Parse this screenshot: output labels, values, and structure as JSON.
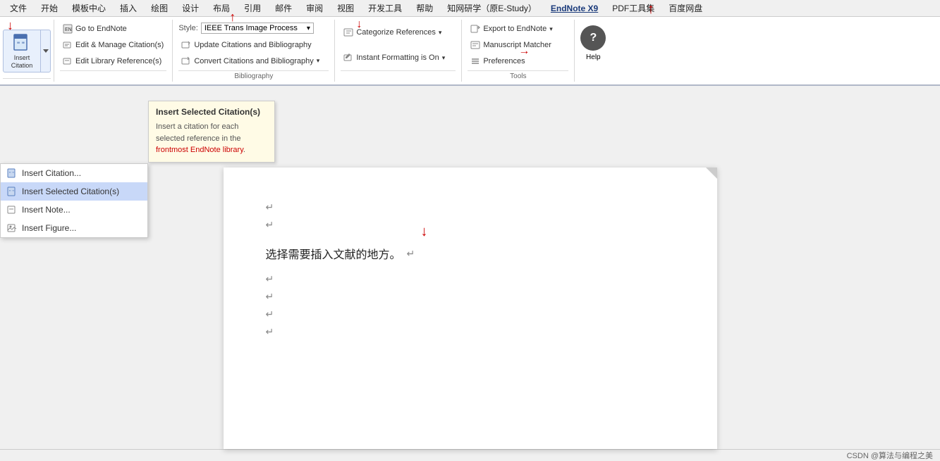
{
  "menubar": {
    "items": [
      "文件",
      "开始",
      "模板中心",
      "插入",
      "绘图",
      "设计",
      "布局",
      "引用",
      "邮件",
      "审阅",
      "视图",
      "开发工具",
      "帮助",
      "知网研学（原E-Study）",
      "EndNote X9",
      "PDF工具集",
      "百度网盘"
    ]
  },
  "ribbon": {
    "insert_citation": {
      "main_label": "Insert\nCitation",
      "dropdown_arrow": "▾"
    },
    "go_to_endnote": "Go to EndNote",
    "edit_manage": "Edit & Manage Citation(s)",
    "edit_library": "Edit Library Reference(s)",
    "style_label": "Style:",
    "style_value": "IEEE Trans Image Process",
    "update_citations": "Update Citations and Bibliography",
    "convert_citations": "Convert Citations and Bibliography",
    "categorize": "Categorize References",
    "instant_formatting": "Instant Formatting is On",
    "export_endnote": "Export to EndNote",
    "manuscript_matcher": "Manuscript Matcher",
    "preferences": "Preferences",
    "help_label": "Help",
    "bibliography_group": "Bibliography",
    "tools_group": "Tools"
  },
  "dropdown": {
    "items": [
      {
        "id": "insert-citation",
        "label": "Insert Citation..."
      },
      {
        "id": "insert-selected",
        "label": "Insert Selected Citation(s)",
        "highlighted": true
      },
      {
        "id": "insert-note",
        "label": "Insert Note..."
      },
      {
        "id": "insert-figure",
        "label": "Insert Figure..."
      }
    ]
  },
  "tooltip": {
    "title": "Insert Selected Citation(s)",
    "text_part1": "Insert a citation for each selected reference in the ",
    "text_highlight": "frontmost EndNote library",
    "text_part2": "."
  },
  "document": {
    "lines": [
      {
        "type": "paragraph_mark"
      },
      {
        "type": "paragraph_mark"
      },
      {
        "type": "text",
        "content": "选择需要插入文献的地方。"
      },
      {
        "type": "paragraph_mark"
      },
      {
        "type": "paragraph_mark"
      },
      {
        "type": "paragraph_mark"
      },
      {
        "type": "paragraph_mark"
      }
    ]
  },
  "status_bar": {
    "label": "CSDN @算法与编程之美"
  },
  "annotations": {
    "arrow1_label": "points to Insert Citation dropdown",
    "arrow2_label": "points to Trans Image Process",
    "arrow3_label": "points to Instant Formatting",
    "arrow4_label": "points to Preferences",
    "arrow5_label": "points to Insert Citation _ label",
    "arrow6_label": "points to document location"
  }
}
